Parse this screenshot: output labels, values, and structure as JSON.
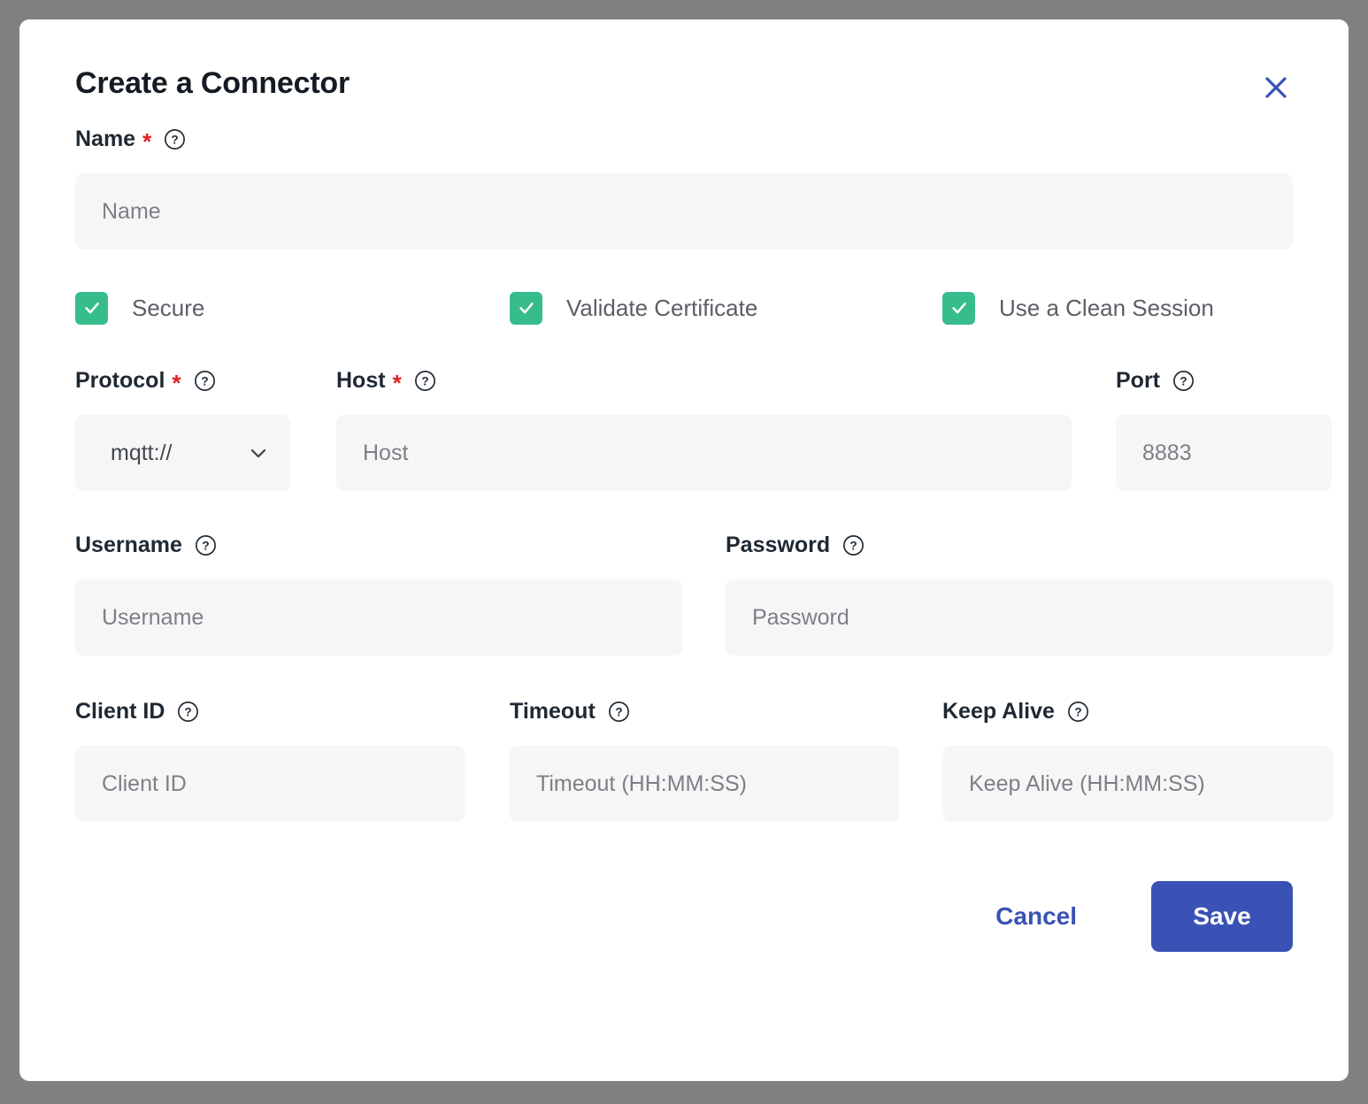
{
  "dialog": {
    "title": "Create a Connector",
    "close_icon": "close-icon"
  },
  "colors": {
    "accent_blue": "#3A52B5",
    "checkbox_green": "#36BD8B",
    "required_red": "#E02020",
    "field_background": "#F6F6F7",
    "overlay": "#808080"
  },
  "fields": {
    "name": {
      "label": "Name",
      "required": "*",
      "help_icon": "help-circle-icon",
      "placeholder": "Name",
      "value": ""
    },
    "protocol": {
      "label": "Protocol",
      "required": "*",
      "help_icon": "help-circle-icon",
      "selected": "mqtt://",
      "chevron_icon": "chevron-down-icon"
    },
    "host": {
      "label": "Host",
      "required": "*",
      "help_icon": "help-circle-icon",
      "placeholder": "Host",
      "value": ""
    },
    "port": {
      "label": "Port",
      "help_icon": "help-circle-icon",
      "placeholder": "8883",
      "value": ""
    },
    "username": {
      "label": "Username",
      "help_icon": "help-circle-icon",
      "placeholder": "Username",
      "value": ""
    },
    "password": {
      "label": "Password",
      "help_icon": "help-circle-icon",
      "placeholder": "Password",
      "value": ""
    },
    "client_id": {
      "label": "Client ID",
      "help_icon": "help-circle-icon",
      "placeholder": "Client ID",
      "value": ""
    },
    "timeout": {
      "label": "Timeout",
      "help_icon": "help-circle-icon",
      "placeholder": "Timeout (HH:MM:SS)",
      "value": ""
    },
    "keep_alive": {
      "label": "Keep Alive",
      "help_icon": "help-circle-icon",
      "placeholder": "Keep Alive (HH:MM:SS)",
      "value": ""
    }
  },
  "checkboxes": [
    {
      "label": "Secure",
      "checked": true,
      "icon": "checkmark-icon"
    },
    {
      "label": "Validate Certificate",
      "checked": true,
      "icon": "checkmark-icon"
    },
    {
      "label": "Use a Clean Session",
      "checked": true,
      "icon": "checkmark-icon"
    }
  ],
  "footer": {
    "cancel_label": "Cancel",
    "save_label": "Save"
  }
}
